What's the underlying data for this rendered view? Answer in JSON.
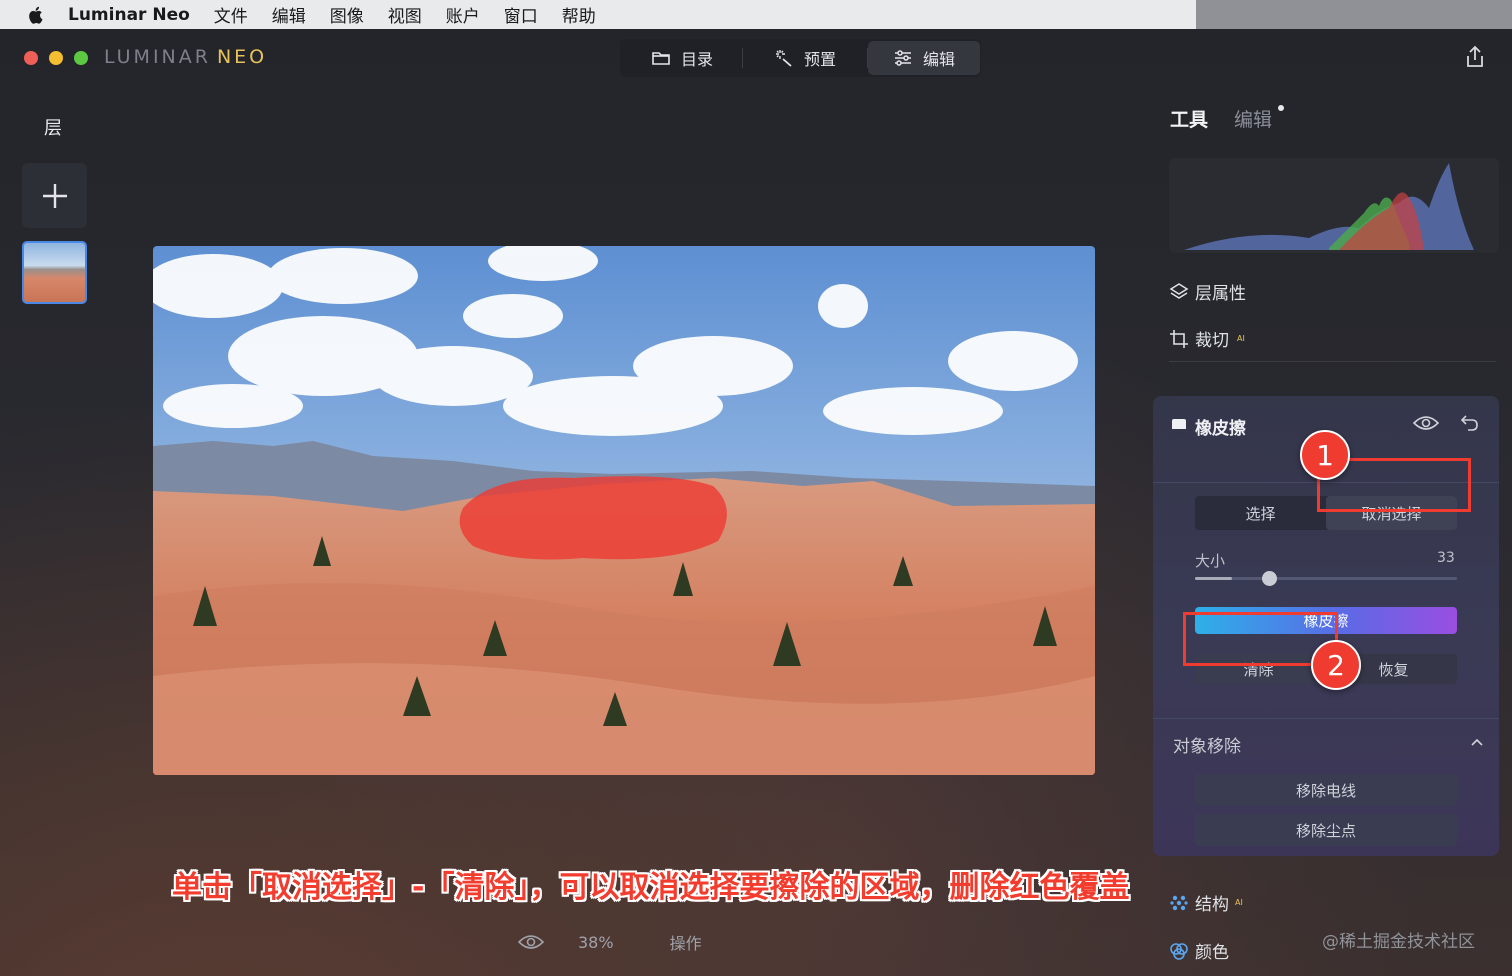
{
  "menubar": {
    "app_name": "Luminar Neo",
    "items": [
      "文件",
      "编辑",
      "图像",
      "视图",
      "账户",
      "窗口",
      "帮助"
    ]
  },
  "brand": {
    "left": "LUMINAR",
    "right": "NEO"
  },
  "mode_tabs": [
    {
      "label": "目录",
      "icon": "folder-icon"
    },
    {
      "label": "预置",
      "icon": "magic-wand-icon"
    },
    {
      "label": "编辑",
      "icon": "sliders-icon",
      "active": true
    }
  ],
  "layers": {
    "title": "层"
  },
  "right_panel": {
    "tab_tools": "工具",
    "tab_edit": "编辑",
    "layer_props": "层属性",
    "crop": "裁切",
    "crop_badge": "AI",
    "eraser": {
      "title": "橡皮擦",
      "select": "选择",
      "deselect": "取消选择",
      "size_label": "大小",
      "size_value": "33",
      "size_fraction": 0.14,
      "erase_button": "橡皮擦",
      "clear": "清除",
      "restore": "恢复",
      "object_removal_title": "对象移除",
      "remove_powerlines": "移除电线",
      "remove_dust": "移除尘点"
    },
    "structure": "结构",
    "structure_badge": "AI",
    "color": "颜色"
  },
  "bottom_bar": {
    "zoom": "38%",
    "actions": "操作"
  },
  "caption": "单击「取消选择」-「清除」，可以取消选择要擦除的区域，删除红色覆盖",
  "annotations": {
    "n1": "1",
    "n2": "2"
  },
  "watermark": "@稀土掘金技术社区",
  "colors": {
    "accent_red": "#ef3b30",
    "gradient_start": "#2eb0e8",
    "gradient_end": "#9a4ee0"
  }
}
